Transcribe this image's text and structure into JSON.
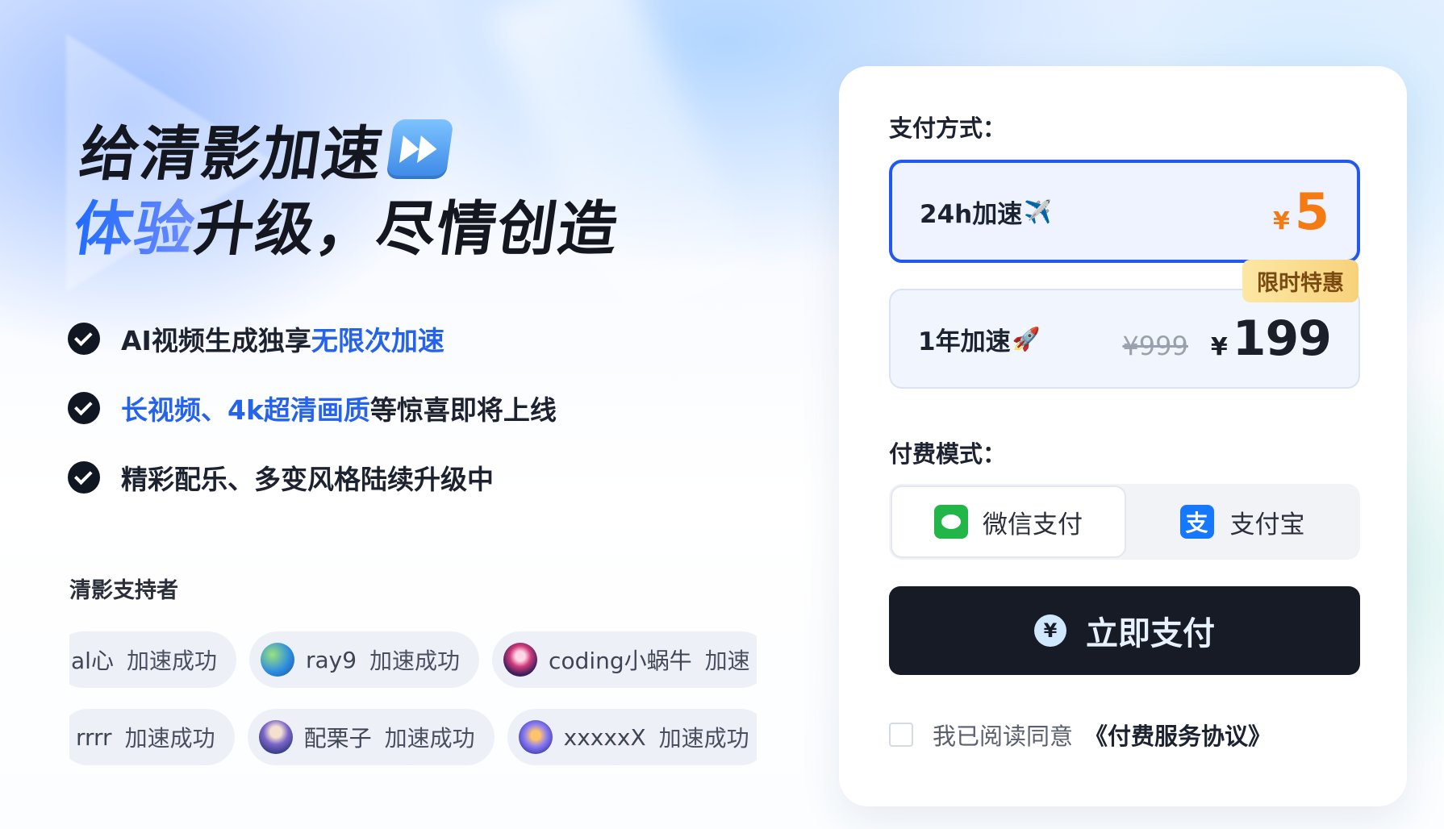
{
  "hero": {
    "title_line1": "给清影加速",
    "title_line2_highlight": "体验",
    "title_line2_rest": "升级，尽情创造"
  },
  "features": [
    {
      "plain_before": "AI视频生成独享",
      "highlight": "无限次加速",
      "plain_after": ""
    },
    {
      "plain_before": "",
      "highlight": "长视频、4k超清画质",
      "plain_after": "等惊喜即将上线"
    },
    {
      "plain_before": "精彩配乐、多变风格陆续升级中",
      "highlight": "",
      "plain_after": ""
    }
  ],
  "supporters": {
    "title": "清影支持者",
    "row1": [
      {
        "user": "al心",
        "status": "加速成功"
      },
      {
        "user": "ray9",
        "status": "加速成功"
      },
      {
        "user": "coding小蜗牛",
        "status": "加速"
      }
    ],
    "row2": [
      {
        "user": "rrrr",
        "status": "加速成功"
      },
      {
        "user": "配栗子",
        "status": "加速成功"
      },
      {
        "user": "xxxxxX",
        "status": "加速成功"
      }
    ]
  },
  "payment": {
    "method_label": "支付方式：",
    "plans": [
      {
        "name": "24h加速",
        "emoji": "✈️",
        "currency": "¥",
        "price": "5"
      },
      {
        "name": "1年加速",
        "emoji": "🚀",
        "original_price": "¥999",
        "currency": "¥",
        "price": "199",
        "badge": "限时特惠"
      }
    ],
    "mode_label": "付费模式：",
    "methods": [
      {
        "label": "微信支付"
      },
      {
        "label": "支付宝",
        "icon_glyph": "支"
      }
    ],
    "pay_button": "立即支付",
    "pay_icon_glyph": "¥",
    "agreement_text": "我已阅读同意",
    "agreement_link": "《付费服务协议》"
  },
  "colors": {
    "accent_blue": "#2358f0",
    "price_orange": "#f57a12",
    "badge_gold": "#f7d27c",
    "wechat_green": "#22b548",
    "alipay_blue": "#1678ff",
    "button_dark": "#161b25"
  },
  "icons": {
    "title_icon": "fast-forward-icon",
    "feature_icon": "check-circle-icon",
    "wechat": "wechat-icon",
    "alipay": "alipay-icon",
    "pay": "yuan-icon"
  }
}
